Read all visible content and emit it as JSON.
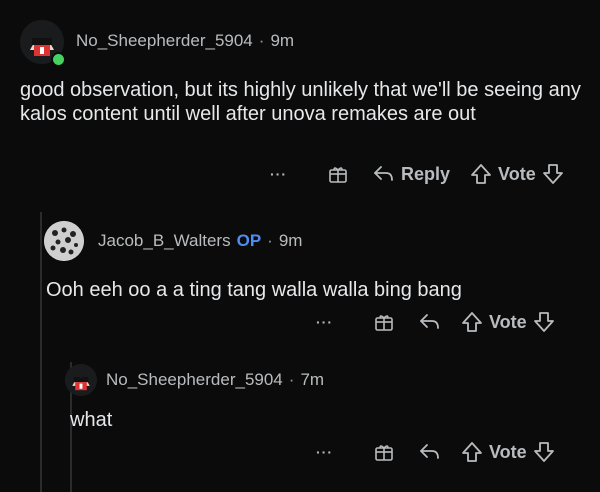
{
  "comments": [
    {
      "username": "No_Sheepherder_5904",
      "time": "9m",
      "body": "good observation, but its highly unlikely that we'll be seeing any kalos content until well after unova remakes are out",
      "more": "···",
      "reply_label": "Reply",
      "vote_label": "Vote"
    },
    {
      "username": "Jacob_B_Walters",
      "op_badge": "OP",
      "time": "9m",
      "body": "Ooh eeh oo a a ting tang walla walla bing bang",
      "more": "···",
      "vote_label": "Vote"
    },
    {
      "username": "No_Sheepherder_5904",
      "time": "7m",
      "body": "what",
      "more": "···",
      "vote_label": "Vote"
    }
  ],
  "separator": "·",
  "colors": {
    "background": "#0b0b0c",
    "op": "#4f8df5",
    "online": "#46d160"
  }
}
